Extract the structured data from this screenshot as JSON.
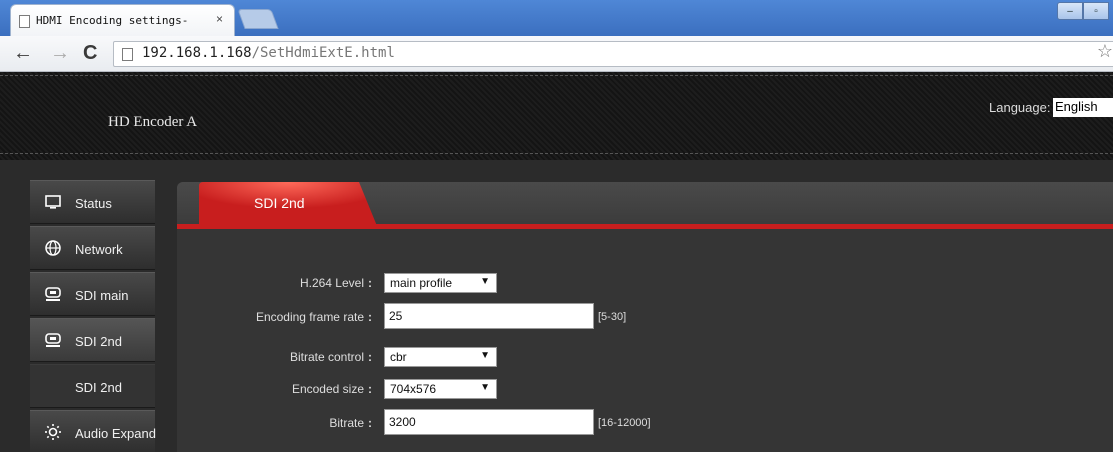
{
  "browser": {
    "tab_title": "HDMI Encoding settings-",
    "tab_close": "×",
    "url_host": "192.168.1.168",
    "url_path": "/SetHdmiExtE.html",
    "back": "←",
    "forward": "→",
    "reload": "C",
    "star": "☆",
    "win_min": "–",
    "win_max": "▫"
  },
  "header": {
    "brand": "HD Encoder  A",
    "language_label": "Language:",
    "language_value": "English"
  },
  "sidebar": {
    "items": [
      {
        "label": "Status",
        "icon": "monitor-icon"
      },
      {
        "label": "Network",
        "icon": "globe-icon"
      },
      {
        "label": "SDI main",
        "icon": "disk-icon"
      },
      {
        "label": "SDI 2nd",
        "icon": "disk-icon"
      },
      {
        "label": "SDI 2nd",
        "icon": ""
      },
      {
        "label": "Audio Expand",
        "icon": "sun-icon"
      }
    ]
  },
  "panel": {
    "tab_label": "SDI 2nd",
    "accent": "#c81e1e",
    "fields": [
      {
        "label": "H.264 Level",
        "type": "select",
        "value": "main profile",
        "hint": ""
      },
      {
        "label": "Encoding frame rate",
        "type": "text",
        "value": "25",
        "hint": "[5-30]"
      },
      {
        "label": "Bitrate control",
        "type": "select",
        "value": "cbr",
        "hint": ""
      },
      {
        "label": "Encoded size",
        "type": "select",
        "value": "704x576",
        "hint": ""
      },
      {
        "label": "Bitrate",
        "type": "text",
        "value": "3200",
        "hint": "[16-12000]"
      }
    ],
    "colon": ":",
    "dropdown_arrow": "▼"
  }
}
